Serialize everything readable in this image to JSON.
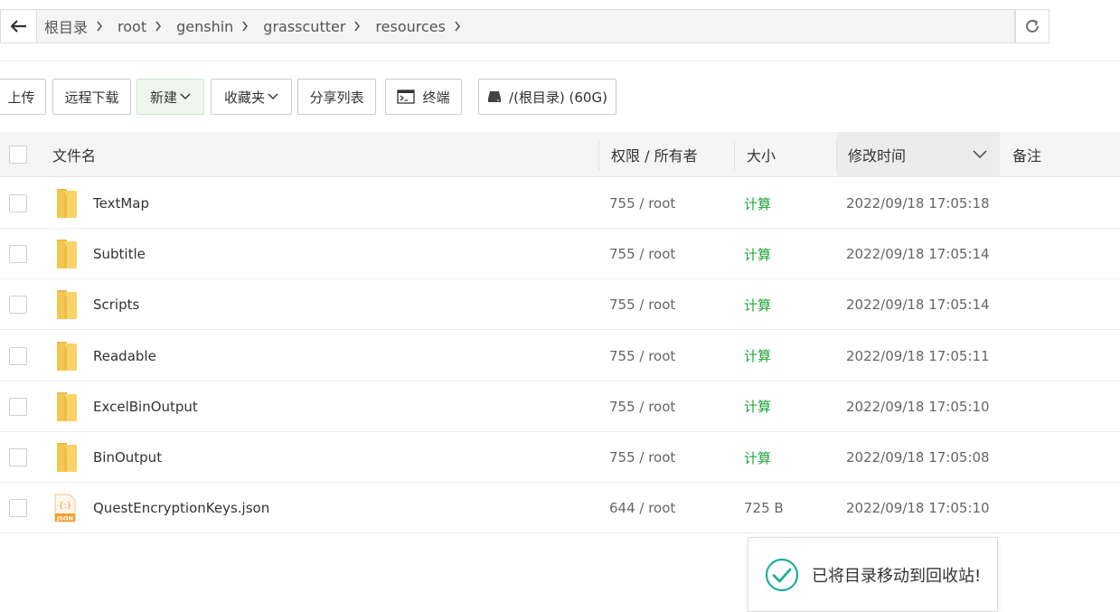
{
  "breadcrumb": {
    "items": [
      "根目录",
      "root",
      "genshin",
      "grasscutter",
      "resources"
    ]
  },
  "toolbar": {
    "upload_label": "上传",
    "remote_download_label": "远程下载",
    "new_label": "新建",
    "favorites_label": "收藏夹",
    "share_list_label": "分享列表",
    "terminal_label": "终端",
    "disk_label": "/(根目录) (60G)"
  },
  "table": {
    "headers": {
      "name": "文件名",
      "perm_owner": "权限 / 所有者",
      "size": "大小",
      "mtime": "修改时间",
      "note": "备注"
    },
    "rows": [
      {
        "name": "TextMap",
        "perm": "755 / root",
        "size": "计算",
        "mtime": "2022/09/18 17:05:18",
        "type": "folder"
      },
      {
        "name": "Subtitle",
        "perm": "755 / root",
        "size": "计算",
        "mtime": "2022/09/18 17:05:14",
        "type": "folder"
      },
      {
        "name": "Scripts",
        "perm": "755 / root",
        "size": "计算",
        "mtime": "2022/09/18 17:05:14",
        "type": "folder"
      },
      {
        "name": "Readable",
        "perm": "755 / root",
        "size": "计算",
        "mtime": "2022/09/18 17:05:11",
        "type": "folder"
      },
      {
        "name": "ExcelBinOutput",
        "perm": "755 / root",
        "size": "计算",
        "mtime": "2022/09/18 17:05:10",
        "type": "folder"
      },
      {
        "name": "BinOutput",
        "perm": "755 / root",
        "size": "计算",
        "mtime": "2022/09/18 17:05:08",
        "type": "folder"
      },
      {
        "name": "QuestEncryptionKeys.json",
        "perm": "644 / root",
        "size": "725 B",
        "mtime": "2022/09/18 17:05:10",
        "type": "json"
      }
    ]
  },
  "json_icon_label": "JSON",
  "toast": {
    "message": "已将目录移动到回收站!"
  },
  "colors": {
    "accent_green": "#20a53a",
    "folder_yellow": "#f7d36b",
    "json_orange": "#f0a030"
  }
}
